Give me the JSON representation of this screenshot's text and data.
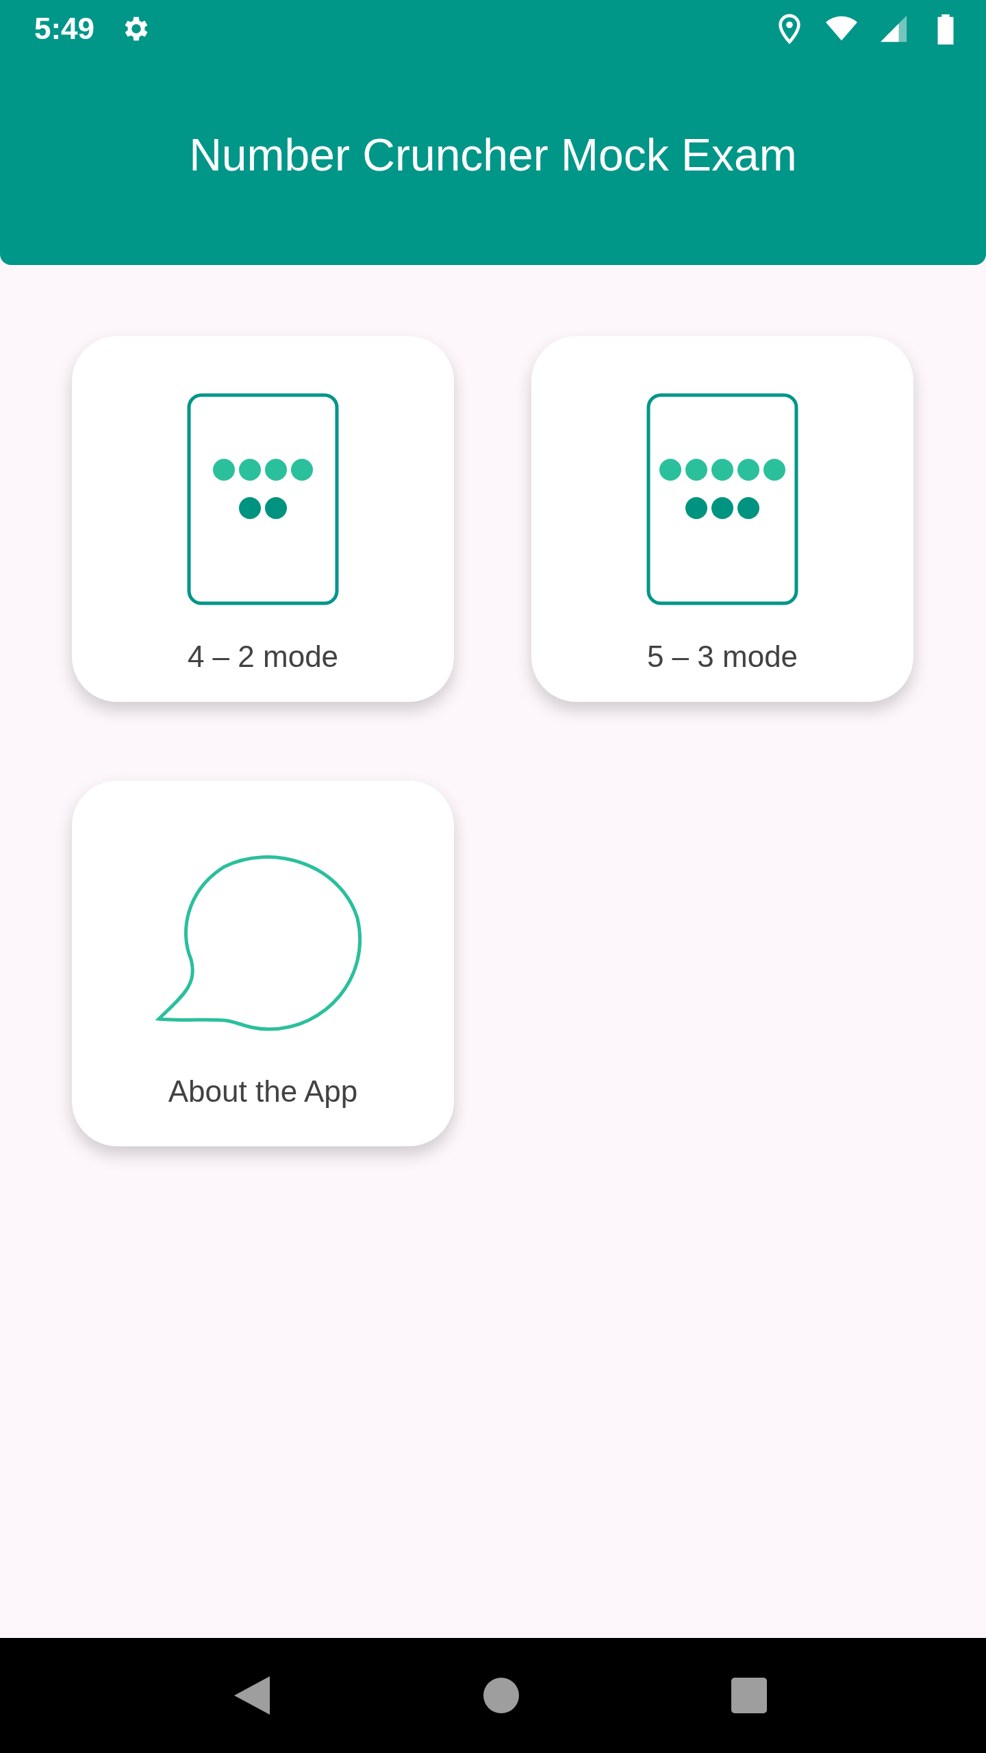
{
  "status_bar": {
    "time": "5:49"
  },
  "app_bar": {
    "title": "Number Cruncher Mock Exam"
  },
  "tiles": [
    {
      "label": "4 – 2 mode",
      "kind": "four-two"
    },
    {
      "label": "5 – 3 mode",
      "kind": "five-three"
    },
    {
      "label": "About the App",
      "kind": "speech"
    }
  ]
}
